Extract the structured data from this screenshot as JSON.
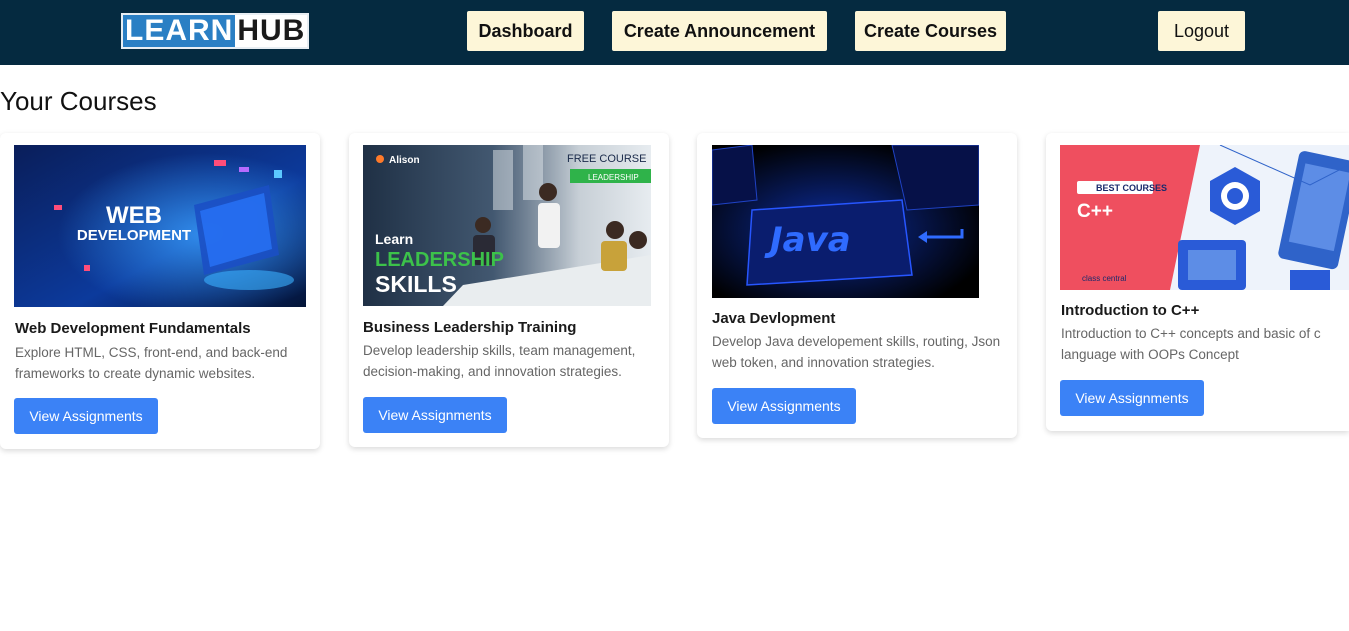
{
  "brand": {
    "logo_part1": "LEARN",
    "logo_part2": "HUB"
  },
  "nav": {
    "dashboard": "Dashboard",
    "create_announcement": "Create Announcement",
    "create_courses": "Create Courses",
    "logout": "Logout"
  },
  "page": {
    "title": "Your Courses"
  },
  "courses": [
    {
      "title": "Web Development Fundamentals",
      "description": "Explore HTML, CSS, front-end, and back-end frameworks to create dynamic websites.",
      "button": "View Assignments",
      "image_text": {
        "line1": "WEB",
        "line2": "DEVELOPMENT"
      }
    },
    {
      "title": "Business Leadership Training",
      "description": "Develop leadership skills, team management, decision-making, and innovation strategies.",
      "button": "View Assignments",
      "image_text": {
        "brand": "Alison",
        "badge": "FREE COURSE",
        "tag": "LEADERSHIP",
        "learn": "Learn",
        "leadership": "LEADERSHIP",
        "skills": "SKILLS"
      }
    },
    {
      "title": "Java Devlopment",
      "description": "Develop Java developement skills, routing, Json web token, and innovation strategies.",
      "button": "View Assignments",
      "image_text": {
        "key": "Java"
      }
    },
    {
      "title": "Introduction to C++",
      "description": "Introduction to C++ concepts and basic of c language with OOPs Concept",
      "button": "View Assignments",
      "image_text": {
        "badge": "BEST COURSES",
        "lang": "C++",
        "footer": "class central"
      }
    }
  ],
  "colors": {
    "navbar": "#052a40",
    "nav_button": "#fdf6d8",
    "primary_button": "#3b82f6"
  }
}
